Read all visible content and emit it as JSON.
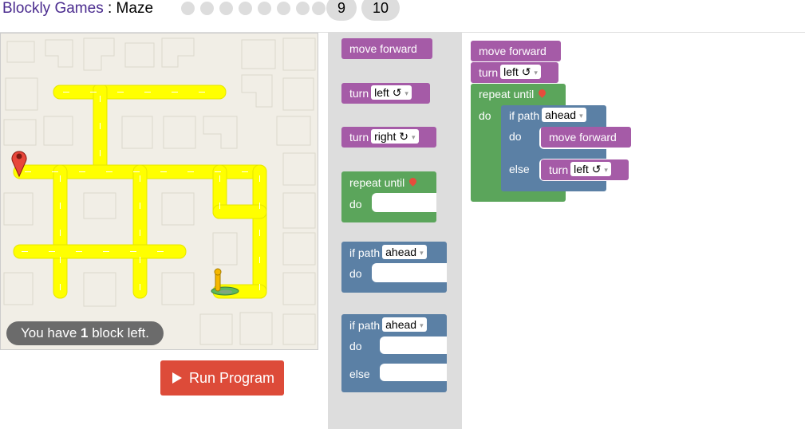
{
  "header": {
    "app_link": "Blockly Games",
    "separator": " : ",
    "page_title": "Maze",
    "levels": [
      "9",
      "10"
    ]
  },
  "maze": {
    "blocks_left_prefix": "You have ",
    "blocks_left_count": "1",
    "blocks_left_suffix": " block left."
  },
  "run_button": {
    "label": "Run Program"
  },
  "toolbox": {
    "move_forward": "move forward",
    "turn_left": {
      "label": "turn",
      "value": "left ↺"
    },
    "turn_right": {
      "label": "turn",
      "value": "right ↻"
    },
    "repeat_until": {
      "label": "repeat until",
      "do": "do"
    },
    "if_path": {
      "label": "if path",
      "value": "ahead",
      "do": "do"
    },
    "if_else": {
      "label": "if path",
      "value": "ahead",
      "do": "do",
      "else": "else"
    }
  },
  "workspace": {
    "move_forward": "move forward",
    "turn": {
      "label": "turn",
      "value": "left ↺"
    },
    "repeat_until": {
      "label": "repeat until",
      "do": "do"
    },
    "if_else": {
      "label": "if path",
      "value": "ahead",
      "do": "do",
      "else": "else",
      "do_block": "move forward",
      "else_block": {
        "label": "turn",
        "value": "left ↺"
      }
    }
  },
  "colors": {
    "motion": "#a55ba7",
    "loop": "#5ba55b",
    "logic": "#5b80a5",
    "path": "#ffff00",
    "run": "#dd4b39"
  }
}
